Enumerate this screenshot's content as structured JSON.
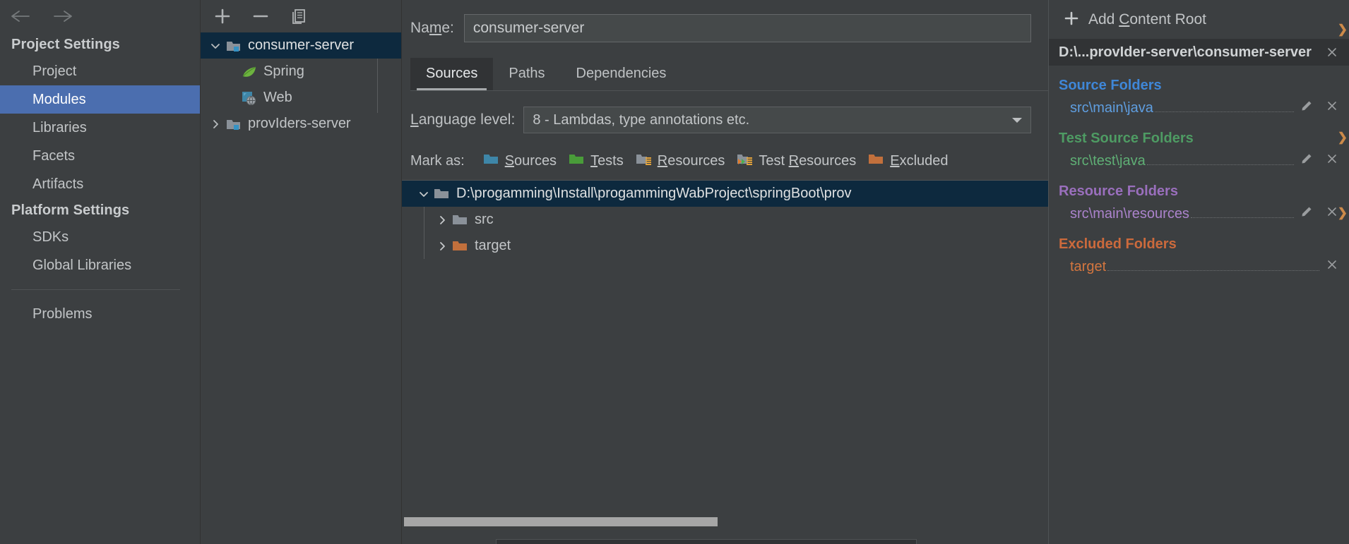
{
  "nav": {
    "back_icon": "arrow-left-icon",
    "forward_icon": "arrow-right-icon",
    "groups": [
      {
        "title": "Project Settings",
        "items": [
          {
            "label": "Project",
            "selected": false
          },
          {
            "label": "Modules",
            "selected": true
          },
          {
            "label": "Libraries",
            "selected": false
          },
          {
            "label": "Facets",
            "selected": false
          },
          {
            "label": "Artifacts",
            "selected": false
          }
        ]
      },
      {
        "title": "Platform Settings",
        "items": [
          {
            "label": "SDKs",
            "selected": false
          },
          {
            "label": "Global Libraries",
            "selected": false
          }
        ]
      }
    ],
    "problems_label": "Problems"
  },
  "modules_panel": {
    "toolbar": {
      "add_label": "+",
      "remove_label": "−",
      "copy_label": "copy-icon"
    },
    "tree": [
      {
        "label": "consumer-server",
        "icon": "module-folder-icon",
        "twisty": "expanded",
        "level": 0,
        "selected": true
      },
      {
        "label": "Spring",
        "icon": "spring-leaf-icon",
        "twisty": "none",
        "level": 1,
        "selected": false
      },
      {
        "label": "Web",
        "icon": "web-facet-icon",
        "twisty": "none",
        "level": 1,
        "selected": false
      },
      {
        "label": "provIders-server",
        "icon": "module-folder-icon",
        "twisty": "collapsed",
        "level": 0,
        "selected": false
      }
    ]
  },
  "main": {
    "name_label_pre": "Na",
    "name_label_mnemonic": "m",
    "name_label_post": "e:",
    "name_value": "consumer-server",
    "tabs": [
      {
        "label": "Sources",
        "active": true
      },
      {
        "label": "Paths",
        "active": false
      },
      {
        "label": "Dependencies",
        "active": false
      }
    ],
    "language_level": {
      "label_pre": "",
      "label_mnemonic": "L",
      "label_post": "anguage level:",
      "value": "8 - Lambdas, type annotations etc.",
      "arrow_icon": "chevron-down-icon"
    },
    "mark_as": {
      "label": "Mark as:",
      "buttons": [
        {
          "label_pre": "",
          "mnemonic": "S",
          "label_post": "ources",
          "icon": "folder-sources-icon",
          "color": "#3e86a8"
        },
        {
          "label_pre": "",
          "mnemonic": "T",
          "label_post": "ests",
          "icon": "folder-tests-icon",
          "color": "#499c39"
        },
        {
          "label_pre": "",
          "mnemonic": "R",
          "label_post": "esources",
          "icon": "folder-resources-icon",
          "color": "#8a9199"
        },
        {
          "label_pre": "Test ",
          "mnemonic": "R",
          "label_post": "esources",
          "icon": "folder-test-resources-icon",
          "color": "#8a9199"
        },
        {
          "label_pre": "",
          "mnemonic": "E",
          "label_post": "xcluded",
          "icon": "folder-excluded-icon",
          "color": "#c2703c"
        }
      ]
    },
    "content_tree": [
      {
        "label": "D:\\progamming\\Install\\progammingWabProject\\springBoot\\prov",
        "icon": "folder-icon",
        "twisty": "expanded",
        "level": 0,
        "selected": true,
        "color": "#8a9199"
      },
      {
        "label": "src",
        "icon": "folder-icon",
        "twisty": "collapsed",
        "level": 1,
        "selected": false,
        "color": "#8a9199"
      },
      {
        "label": "target",
        "icon": "folder-excluded-icon",
        "twisty": "collapsed",
        "level": 1,
        "selected": false,
        "color": "#c2703c"
      }
    ]
  },
  "details": {
    "add_content_root": {
      "label_pre": "Add ",
      "mnemonic": "C",
      "label_post": "ontent Root",
      "plus_icon": "plus-icon"
    },
    "content_root_path": "D:\\...provIder-server\\consumer-server",
    "content_root_remove_icon": "close-icon",
    "sections": [
      {
        "title": "Source Folders",
        "kind": "sources",
        "color": "#3f87d8",
        "folders": [
          {
            "path": "src\\main\\java",
            "has_edit": true,
            "has_remove": true
          }
        ]
      },
      {
        "title": "Test Source Folders",
        "kind": "tests",
        "color": "#4e9b63",
        "folders": [
          {
            "path": "src\\test\\java",
            "has_edit": true,
            "has_remove": true
          }
        ]
      },
      {
        "title": "Resource Folders",
        "kind": "resources",
        "color": "#9a6fbd",
        "folders": [
          {
            "path": "src\\main\\resources",
            "has_edit": true,
            "has_remove": true
          }
        ]
      },
      {
        "title": "Excluded Folders",
        "kind": "excluded",
        "color": "#cc6a3c",
        "folders": [
          {
            "path": "target",
            "has_edit": false,
            "has_remove": true
          }
        ]
      }
    ],
    "edit_icon": "pencil-icon",
    "remove_icon": "close-icon"
  },
  "colors": {
    "background": "#3c3f41",
    "selection_blue": "#4b6eaf",
    "tree_selection": "#0d293e",
    "tab_active_bg": "#313335",
    "accent_orange": "#cc8a4a"
  }
}
